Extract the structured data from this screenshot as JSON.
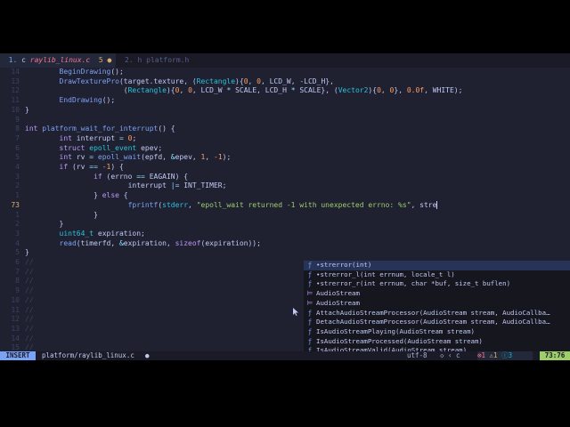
{
  "tabs": [
    {
      "index": "1.",
      "lang": "c",
      "name": "raylib_linux.c",
      "count": "5",
      "modified": "●"
    },
    {
      "index": "2.",
      "lang": "h",
      "name": "platform.h"
    }
  ],
  "editor_lines": [
    {
      "n": "14",
      "tokens": [
        [
          "        ",
          ""
        ],
        [
          "BeginDrawing",
          "f"
        ],
        [
          "();",
          ""
        ]
      ]
    },
    {
      "n": "13",
      "tokens": [
        [
          "        ",
          ""
        ],
        [
          "DrawTexturePro",
          "f"
        ],
        [
          "(target.texture, (",
          ""
        ],
        [
          "Rectangle",
          "t"
        ],
        [
          ")",
          ""
        ],
        [
          "{",
          ""
        ],
        [
          "0",
          "n"
        ],
        [
          ", ",
          ""
        ],
        [
          "0",
          "n"
        ],
        [
          ", LCD_W, ",
          ""
        ],
        [
          "-",
          "o"
        ],
        [
          "LCD_H},",
          ""
        ]
      ]
    },
    {
      "n": "12",
      "tokens": [
        [
          "                       (",
          ""
        ],
        [
          "Rectangle",
          "t"
        ],
        [
          ")",
          ""
        ],
        [
          "{",
          ""
        ],
        [
          "0",
          "n"
        ],
        [
          ", ",
          ""
        ],
        [
          "0",
          "n"
        ],
        [
          ", LCD_W ",
          ""
        ],
        [
          "*",
          "o"
        ],
        [
          " SCALE, LCD_H ",
          ""
        ],
        [
          "*",
          "o"
        ],
        [
          " SCALE}, (",
          ""
        ],
        [
          "Vector2",
          "t"
        ],
        [
          ")",
          ""
        ],
        [
          "{",
          ""
        ],
        [
          "0",
          "n"
        ],
        [
          ", ",
          ""
        ],
        [
          "0",
          "n"
        ],
        [
          "}, ",
          ""
        ],
        [
          "0.0f",
          "n"
        ],
        [
          ", WHITE);",
          ""
        ]
      ]
    },
    {
      "n": "11",
      "tokens": [
        [
          "        ",
          ""
        ],
        [
          "EndDrawing",
          "f"
        ],
        [
          "();",
          ""
        ]
      ]
    },
    {
      "n": "10",
      "tokens": [
        [
          "}",
          ""
        ]
      ]
    },
    {
      "n": "9",
      "tokens": []
    },
    {
      "n": "8",
      "tokens": [
        [
          "int",
          "k"
        ],
        [
          " ",
          ""
        ],
        [
          "platform_wait_for_interrupt",
          "f"
        ],
        [
          "() {",
          ""
        ]
      ]
    },
    {
      "n": "7",
      "tokens": [
        [
          "        ",
          ""
        ],
        [
          "int",
          "k"
        ],
        [
          " interrupt ",
          ""
        ],
        [
          "=",
          "o"
        ],
        [
          " ",
          ""
        ],
        [
          "0",
          "n"
        ],
        [
          ";",
          ""
        ]
      ]
    },
    {
      "n": "6",
      "tokens": [
        [
          "        ",
          ""
        ],
        [
          "struct",
          "k"
        ],
        [
          " ",
          ""
        ],
        [
          "epoll_event",
          "t"
        ],
        [
          " epev;",
          ""
        ]
      ]
    },
    {
      "n": "5",
      "tokens": [
        [
          "        ",
          ""
        ],
        [
          "int",
          "k"
        ],
        [
          " rv ",
          ""
        ],
        [
          "=",
          "o"
        ],
        [
          " ",
          ""
        ],
        [
          "epoll_wait",
          "f"
        ],
        [
          "(epfd, ",
          ""
        ],
        [
          "&",
          "o"
        ],
        [
          "epev, ",
          ""
        ],
        [
          "1",
          "n"
        ],
        [
          ", ",
          ""
        ],
        [
          "-1",
          "n"
        ],
        [
          ");",
          ""
        ]
      ]
    },
    {
      "n": "4",
      "tokens": [
        [
          "        ",
          ""
        ],
        [
          "if",
          "k"
        ],
        [
          " (rv ",
          ""
        ],
        [
          "==",
          "o"
        ],
        [
          " ",
          ""
        ],
        [
          "-1",
          "n"
        ],
        [
          ") {",
          ""
        ]
      ]
    },
    {
      "n": "3",
      "tokens": [
        [
          "                ",
          ""
        ],
        [
          "if",
          "k"
        ],
        [
          " (errno ",
          ""
        ],
        [
          "==",
          "o"
        ],
        [
          " EAGAIN) {",
          ""
        ]
      ]
    },
    {
      "n": "2",
      "tokens": [
        [
          "                        interrupt ",
          ""
        ],
        [
          "|=",
          "o"
        ],
        [
          " INT_TIMER;",
          ""
        ]
      ]
    },
    {
      "n": "1",
      "tokens": [
        [
          "                } ",
          ""
        ],
        [
          "else",
          "k"
        ],
        [
          " {",
          ""
        ]
      ]
    },
    {
      "n": "73",
      "current": true,
      "tokens": [
        [
          "                        ",
          ""
        ],
        [
          "fprintf",
          "f"
        ],
        [
          "(",
          ""
        ],
        [
          "stderr",
          "t"
        ],
        [
          ", ",
          ""
        ],
        [
          "\"epoll_wait returned -1 with unexpected errno: %s\"",
          "s"
        ],
        [
          ", stre",
          ""
        ]
      ]
    },
    {
      "n": "1",
      "tokens": [
        [
          "                }",
          ""
        ]
      ]
    },
    {
      "n": "2",
      "tokens": [
        [
          "        }",
          ""
        ]
      ]
    },
    {
      "n": "3",
      "tokens": [
        [
          "        ",
          ""
        ],
        [
          "uint64_t",
          "t"
        ],
        [
          " expiration;",
          ""
        ]
      ]
    },
    {
      "n": "4",
      "tokens": [
        [
          "        ",
          ""
        ],
        [
          "read",
          "f"
        ],
        [
          "(timerfd, ",
          ""
        ],
        [
          "&",
          "o"
        ],
        [
          "expiration, ",
          ""
        ],
        [
          "sizeof",
          "k"
        ],
        [
          "(expiration));",
          ""
        ]
      ]
    },
    {
      "n": "5",
      "tokens": [
        [
          "}",
          ""
        ]
      ]
    },
    {
      "n": "6",
      "tokens": [
        [
          "//",
          "cm"
        ]
      ]
    },
    {
      "n": "7",
      "tokens": [
        [
          "//",
          "cm"
        ]
      ]
    },
    {
      "n": "8",
      "tokens": [
        [
          "//",
          "cm"
        ]
      ]
    },
    {
      "n": "9",
      "tokens": [
        [
          "//",
          "cm"
        ]
      ]
    },
    {
      "n": "10",
      "tokens": [
        [
          "//",
          "cm"
        ]
      ]
    },
    {
      "n": "11",
      "tokens": [
        [
          "//",
          "cm"
        ]
      ]
    },
    {
      "n": "12",
      "tokens": [
        [
          "//",
          "cm"
        ]
      ]
    },
    {
      "n": "13",
      "tokens": [
        [
          "//",
          "cm"
        ]
      ]
    },
    {
      "n": "14",
      "tokens": [
        [
          "//",
          "cm"
        ]
      ]
    },
    {
      "n": "15",
      "tokens": [
        [
          "//",
          "cm"
        ]
      ]
    }
  ],
  "completion_items": [
    {
      "kind": "ƒ",
      "label": "•strerror(int)",
      "selected": true
    },
    {
      "kind": "ƒ",
      "label": "•strerror_l(int errnum, locale_t l)"
    },
    {
      "kind": "ƒ",
      "label": "•strerror_r(int errnum, char *buf, size_t buflen)"
    },
    {
      "kind": "⊨",
      "label": "AudioStream",
      "mod": true
    },
    {
      "kind": "⊨",
      "label": "AudioStream",
      "mod": true
    },
    {
      "kind": "ƒ",
      "label": "AttachAudioStreamProcessor(AudioStream stream, AudioCallba…"
    },
    {
      "kind": "ƒ",
      "label": "DetachAudioStreamProcessor(AudioStream stream, AudioCallba…"
    },
    {
      "kind": "ƒ",
      "label": "IsAudioStreamPlaying(AudioStream stream)"
    },
    {
      "kind": "ƒ",
      "label": "IsAudioStreamProcessed(AudioStream stream)"
    },
    {
      "kind": "ƒ",
      "label": "IsAudioStreamValid(AudioStream stream)"
    }
  ],
  "statusbar": {
    "mode": "INSERT",
    "file": "platform/raylib_linux.c",
    "modified_dot": "●",
    "encoding": "utf-8",
    "git": "◇ ‹",
    "filetype": "c",
    "errors": "⊗1",
    "warnings": "⚠1",
    "info": "ⓘ3",
    "position": "73:76"
  },
  "colors": {
    "background": "#1f2030",
    "accent": "#7aa2f7",
    "string": "#9ece6a",
    "keyword": "#bb9af7"
  }
}
